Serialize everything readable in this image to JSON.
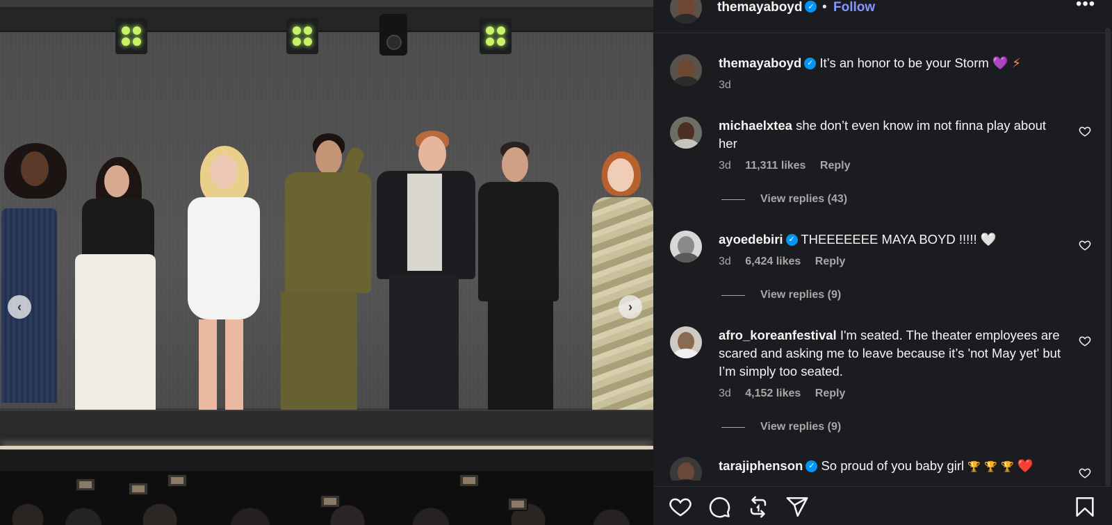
{
  "post": {
    "author": "themayaboyd",
    "verified": true,
    "separator": "•",
    "follow_label": "Follow",
    "more_label": "•••"
  },
  "caption": {
    "user": "themayaboyd",
    "text": "It’s an honor to be your Storm",
    "emoji": [
      "💜",
      "⚡"
    ],
    "time": "3d"
  },
  "comments": [
    {
      "user": "michaelxtea",
      "verified": false,
      "text": "she don’t even know im not finna play about her",
      "time": "3d",
      "likes": "11,311 likes",
      "reply_label": "Reply",
      "view_replies": "View replies (43)"
    },
    {
      "user": "ayoedebiri",
      "verified": true,
      "text": "THEEEEEEE MAYA BOYD !!!!!",
      "emoji": "🤍",
      "time": "3d",
      "likes": "6,424 likes",
      "reply_label": "Reply",
      "view_replies": "View replies (9)"
    },
    {
      "user": "afro_koreanfestival",
      "verified": false,
      "text": "I'm seated. The theater employees are scared and asking me to leave because it’s 'not May yet' but I’m simply too seated.",
      "time": "3d",
      "likes": "4,152 likes",
      "reply_label": "Reply",
      "view_replies": "View replies (9)"
    },
    {
      "user": "tarajiphenson",
      "verified": true,
      "text": "So proud of you baby girl",
      "emoji": [
        "🏆",
        "🏆",
        "🏆",
        "❤️"
      ]
    }
  ],
  "icons": {
    "like": "heart-icon",
    "comment": "comment-icon",
    "share": "repost-icon",
    "send": "send-icon",
    "save": "bookmark-icon",
    "prev": "chevron-left-icon",
    "next": "chevron-right-icon"
  },
  "carousel": {
    "prev_label": "‹",
    "next_label": "›"
  },
  "colors": {
    "background": "#1b1c20",
    "follow": "#8497ff",
    "verified": "#0095f6",
    "muted_text": "#a8a8a8"
  }
}
